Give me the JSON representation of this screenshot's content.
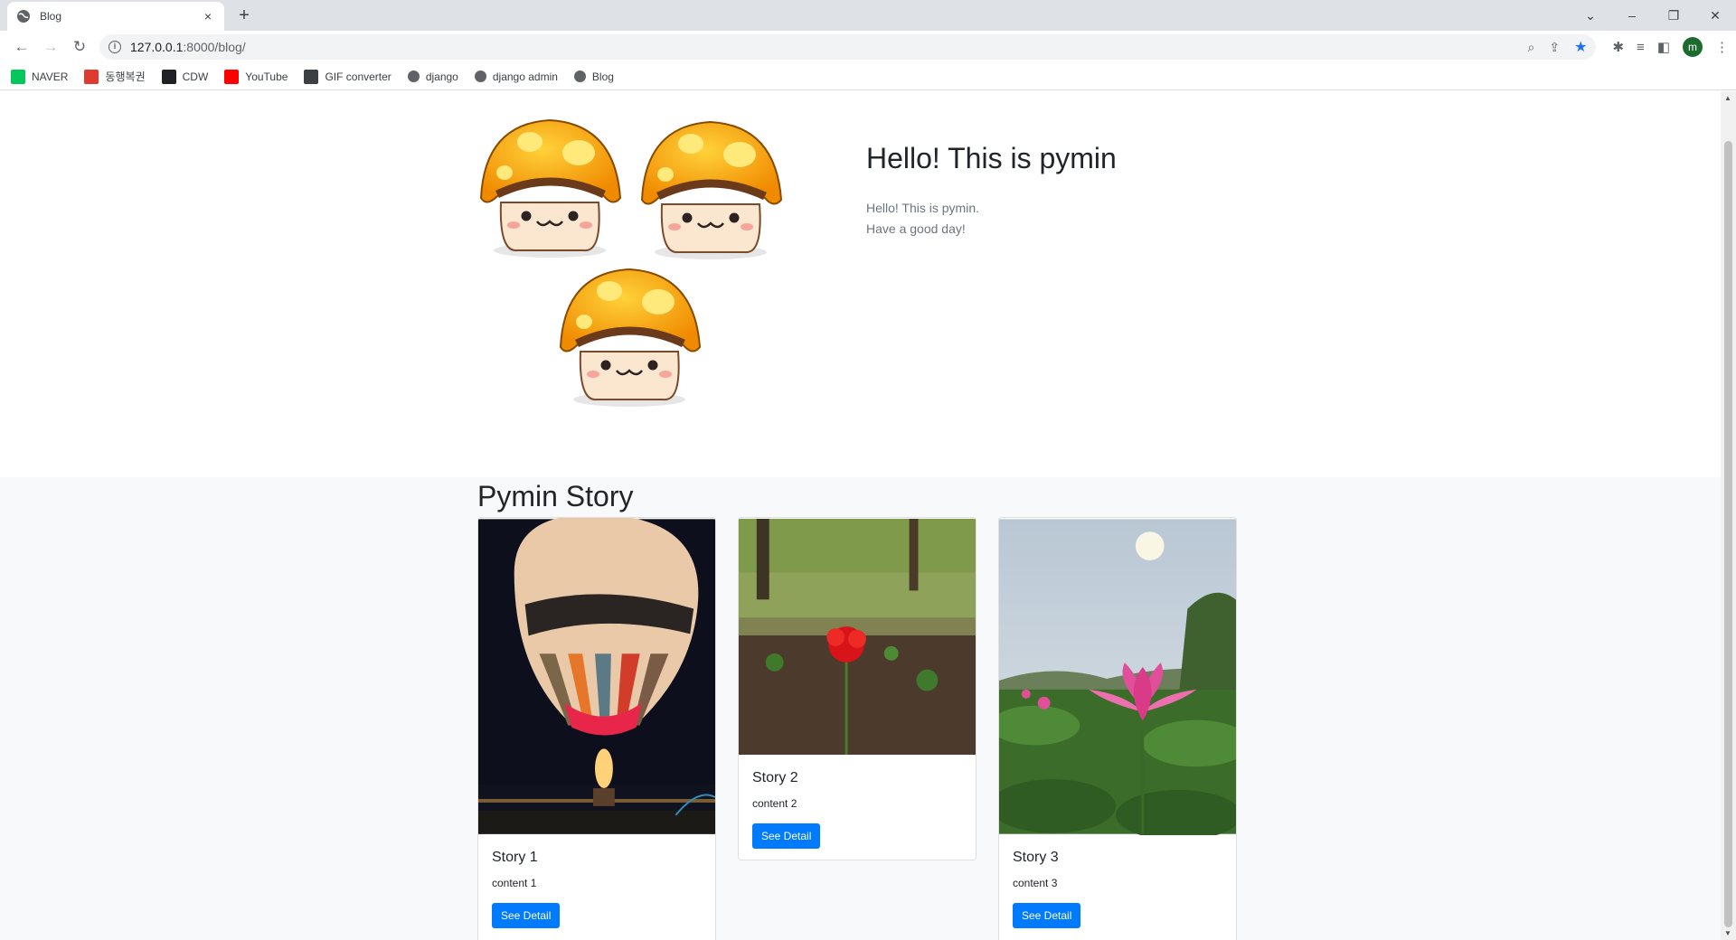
{
  "browser": {
    "tab_title": "Blog",
    "tab_close": "×",
    "new_tab": "+",
    "url_host": "127.0.0.1",
    "url_path": ":8000/blog/",
    "avatar_letter": "m",
    "window_controls": [
      "⌄",
      "–",
      "❐",
      "✕"
    ],
    "bookmarks": [
      {
        "label": "NAVER",
        "icon": "naver-icon",
        "color": "#03c75a"
      },
      {
        "label": "동행복권",
        "icon": "lottery-icon",
        "color": "#e03b2f"
      },
      {
        "label": "CDW",
        "icon": "cdw-icon",
        "color": "#202124"
      },
      {
        "label": "YouTube",
        "icon": "youtube-icon",
        "color": "#ff0000"
      },
      {
        "label": "GIF converter",
        "icon": "gif-icon",
        "color": "#3c4043"
      },
      {
        "label": "django",
        "icon": "globe-icon",
        "color": "#5f6368"
      },
      {
        "label": "django admin",
        "icon": "globe-icon",
        "color": "#5f6368"
      },
      {
        "label": "Blog",
        "icon": "globe-icon",
        "color": "#5f6368"
      }
    ]
  },
  "hero": {
    "title": "Hello! This is pymin",
    "line1": "Hello! This is pymin.",
    "line2": "Have a good day!"
  },
  "stories": {
    "heading": "Pymin Story",
    "cards": [
      {
        "title": "Story 1",
        "content": "content 1",
        "button": "See Detail",
        "image": "hot-air-balloon-photo"
      },
      {
        "title": "Story 2",
        "content": "content 2",
        "button": "See Detail",
        "image": "red-flower-photo"
      },
      {
        "title": "Story 3",
        "content": "content 3",
        "button": "See Detail",
        "image": "lotus-photo"
      }
    ]
  },
  "colors": {
    "accent": "#007bff",
    "section_bg": "#f8f9fa"
  }
}
